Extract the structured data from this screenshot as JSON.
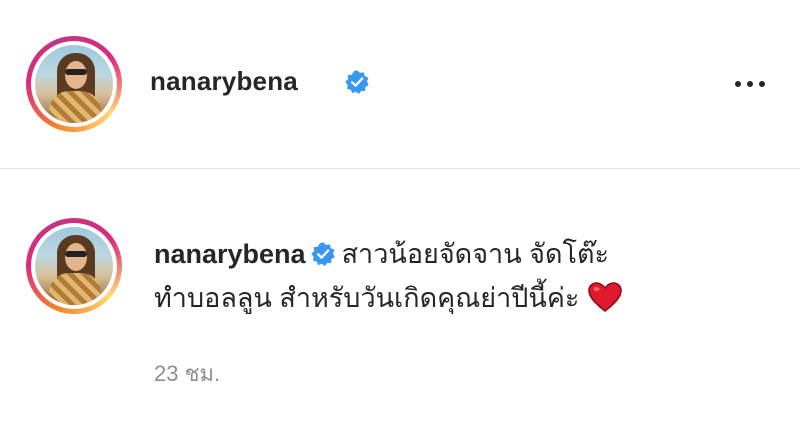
{
  "header": {
    "username": "nanarybena",
    "more_icon": "more-horizontal-icon"
  },
  "post": {
    "username": "nanarybena",
    "caption_line1": "สาวน้อยจัดจาน จัดโต๊ะ",
    "caption_line2": "ทำบอลลูน สำหรับวันเกิดคุณย่าปีนี้ค่ะ",
    "emoji": "red-heart-icon",
    "timestamp": "23 ชม."
  },
  "colors": {
    "verified": "#3897f0",
    "heart": "#e0192d",
    "divider": "#e3e3e3",
    "muted": "#8e8e8e"
  }
}
